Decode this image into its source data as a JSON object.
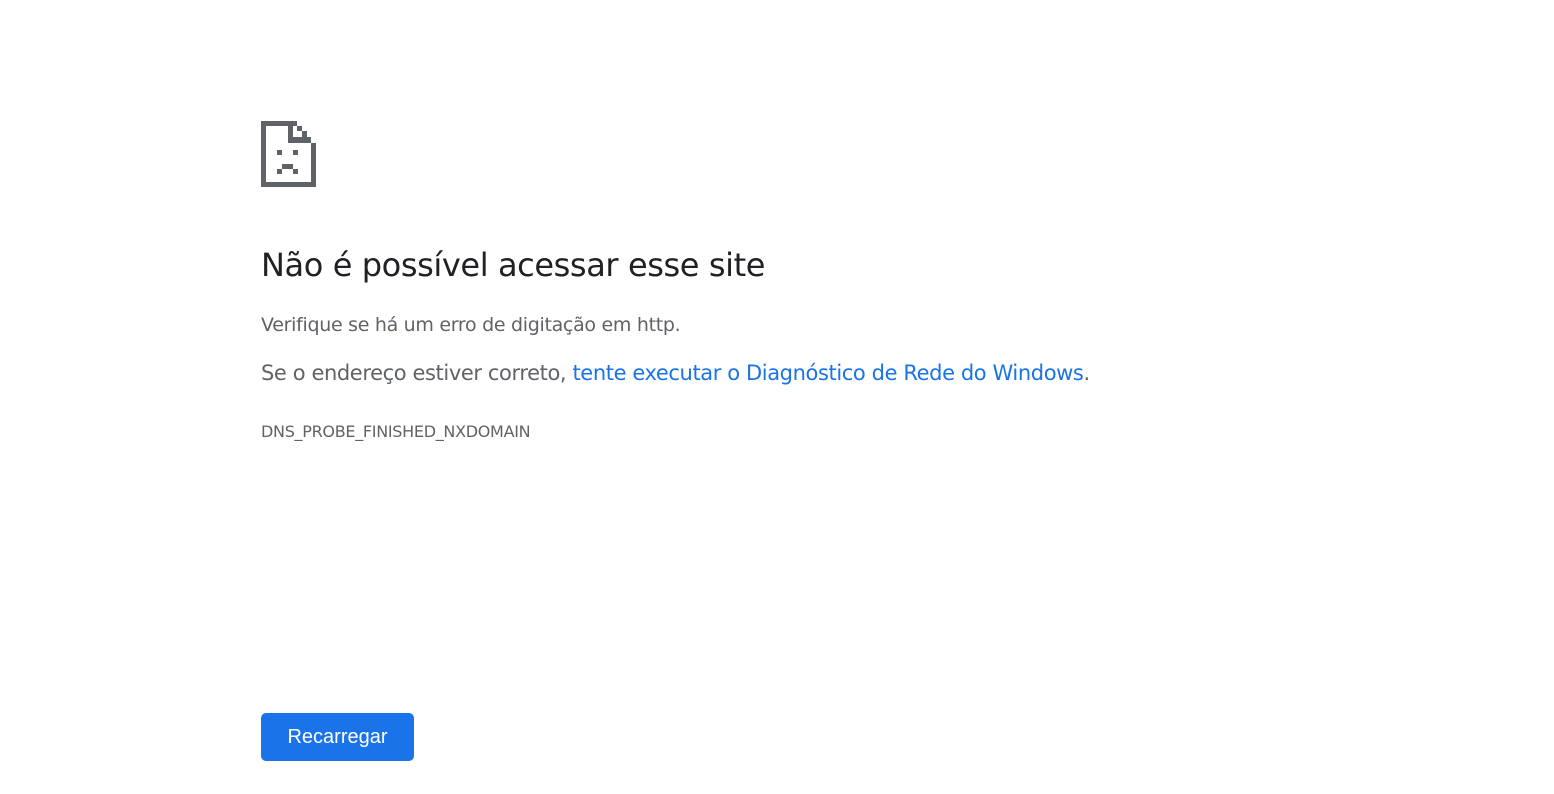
{
  "icon": "sad-page-icon",
  "title": "Não é possível acessar esse site",
  "message1": "Verifique se há um erro de digitação em http.",
  "message2_prefix": "Se o endereço estiver correto, ",
  "message2_link": "tente executar o Diagnóstico de Rede do Windows",
  "message2_suffix": ".",
  "error_code": "DNS_PROBE_FINISHED_NXDOMAIN",
  "button_label": "Recarregar",
  "colors": {
    "title": "#202124",
    "text": "#5f6368",
    "link": "#1a73e8",
    "button": "#1a73e8",
    "icon": "#5f6368"
  }
}
